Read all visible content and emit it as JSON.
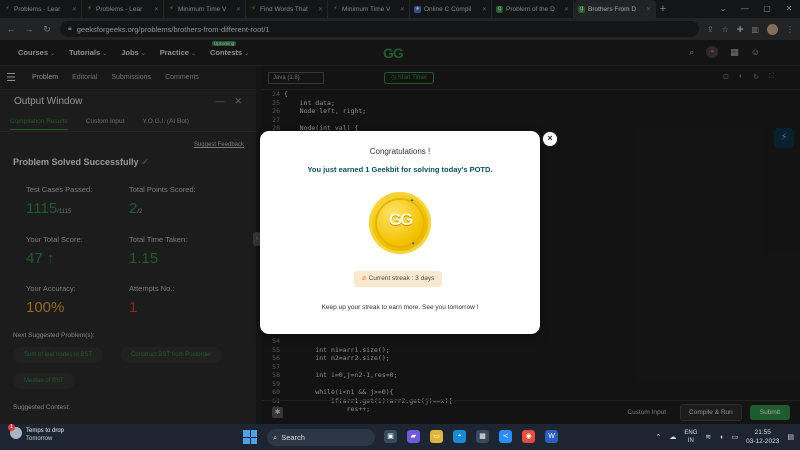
{
  "browser": {
    "tabs": [
      {
        "label": "Problems - Lear",
        "color": "#e0b020"
      },
      {
        "label": "Problems - Lear",
        "color": "#e0b020"
      },
      {
        "label": "Minimum Time V",
        "color": "#e0b020"
      },
      {
        "label": "Find Words That",
        "color": "#e0b020"
      },
      {
        "label": "Minimum Time V",
        "color": "#e0b020"
      },
      {
        "label": "Online C Compil",
        "color": "#4a7ad8"
      },
      {
        "label": "Problem of the D",
        "color": "#2f8d46"
      },
      {
        "label": "Brothers From D",
        "color": "#2f8d46"
      }
    ],
    "new_tab": "+",
    "url": "geeksforgeeks.org/problems/brothers-from-different-root/1"
  },
  "gfg_header": {
    "nav": [
      "Courses",
      "Tutorials",
      "Jobs",
      "Practice",
      "Contests"
    ],
    "upcoming_badge": "Upcoming",
    "logo": "GG"
  },
  "problem_tabs": [
    "Problem",
    "Editorial",
    "Submissions",
    "Comments"
  ],
  "output_window": {
    "title": "Output Window",
    "tabs": [
      "Compilation Results",
      "Custom Input",
      "Y.O.G.I. (AI Bot)"
    ],
    "feedback": "Suggest Feedback",
    "solved": "Problem Solved Successfully",
    "stats": {
      "test_cases_label": "Test Cases Passed:",
      "test_cases_value": "1115",
      "test_cases_total": "/1115",
      "points_label": "Total Points Scored:",
      "points_value": "2",
      "points_total": "/2",
      "score_label": "Your Total Score:",
      "score_value": "47",
      "time_label": "Total Time Taken:",
      "time_value": "1.15",
      "accuracy_label": "Your Accuracy:",
      "accuracy_value": "100%",
      "attempts_label": "Attempts No.:",
      "attempts_value": "1"
    },
    "next_label": "Next Suggested Problem(s):",
    "suggested": [
      "Sum of leaf nodes in BST",
      "Construct BST from Postorder",
      "Median of BST"
    ],
    "contest_label": "Suggested Contest:"
  },
  "editor": {
    "language": "Java (1.8)",
    "timer": "Start Timer",
    "lines": [
      {
        "n": "24",
        "t": "{"
      },
      {
        "n": "25",
        "t": "    int data;"
      },
      {
        "n": "26",
        "t": "    Node left, right;"
      },
      {
        "n": "27",
        "t": ""
      },
      {
        "n": "28",
        "t": "    Node(int val) {"
      },
      {
        "n": "54",
        "t": ""
      },
      {
        "n": "55",
        "t": "        int n1=arr1.size();"
      },
      {
        "n": "56",
        "t": "        int n2=arr2.size();"
      },
      {
        "n": "57",
        "t": ""
      },
      {
        "n": "58",
        "t": "        int i=0,j=n2-1,res=0;"
      },
      {
        "n": "59",
        "t": ""
      },
      {
        "n": "60",
        "t": "        while(i<n1 && j>=0){"
      },
      {
        "n": "61",
        "t": "            if(arr1.get(i)+arr2.get(j)==x){"
      },
      {
        "n": "62",
        "t": "                res++;"
      }
    ],
    "custom_input": "Custom Input",
    "compile_run": "Compile & Run",
    "submit": "Submit"
  },
  "modal": {
    "title": "Congratulations !",
    "subtitle": "You just earned 1 Geekbit for solving today's POTD.",
    "streak": "Current streak : 3 days",
    "footer": "Keep up your streak to earn more. See you tomorrow !",
    "close": "×",
    "coin_logo": "GG"
  },
  "taskbar": {
    "weather_title": "Temps to drop",
    "weather_sub": "Tomorrow",
    "weather_badge": "1",
    "search": "Search",
    "lang_top": "ENG",
    "lang_bottom": "IN",
    "time": "21:55",
    "date": "03-12-2023"
  }
}
